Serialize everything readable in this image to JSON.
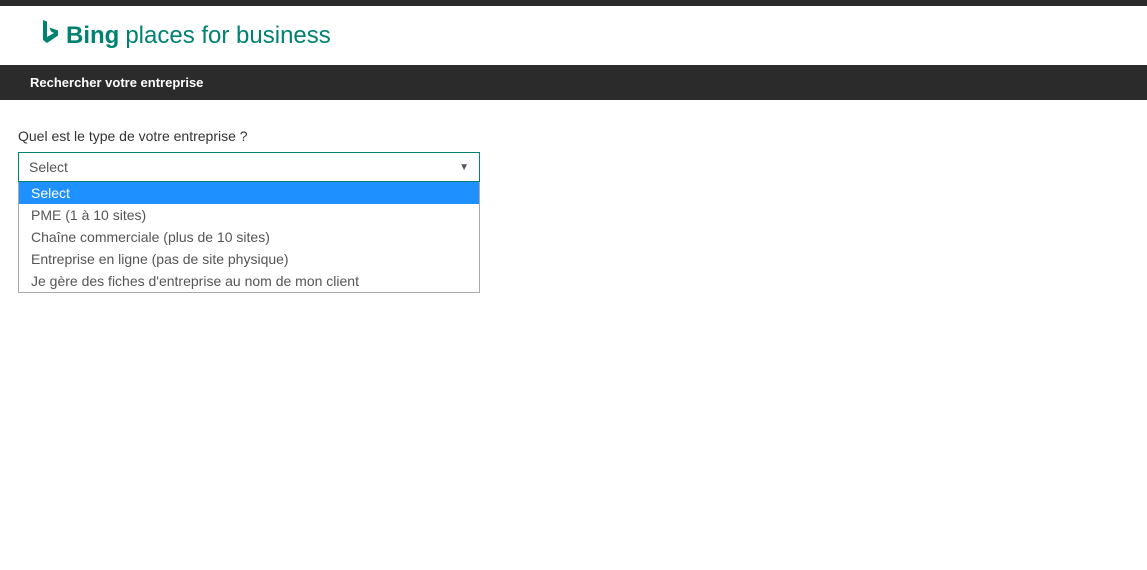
{
  "header": {
    "logo_bold": "Bing",
    "logo_light": "places for business"
  },
  "subheader": {
    "title": "Rechercher votre entreprise"
  },
  "form": {
    "question": "Quel est le type de votre entreprise ?",
    "select_value": "Select",
    "options": [
      "Select",
      "PME (1 à 10 sites)",
      "Chaîne commerciale (plus de 10 sites)",
      "Entreprise en ligne (pas de site physique)",
      "Je gère des fiches d'entreprise au nom de mon client"
    ],
    "selected_index": 0
  },
  "colors": {
    "brand": "#008272",
    "highlight": "#1e90ff"
  }
}
